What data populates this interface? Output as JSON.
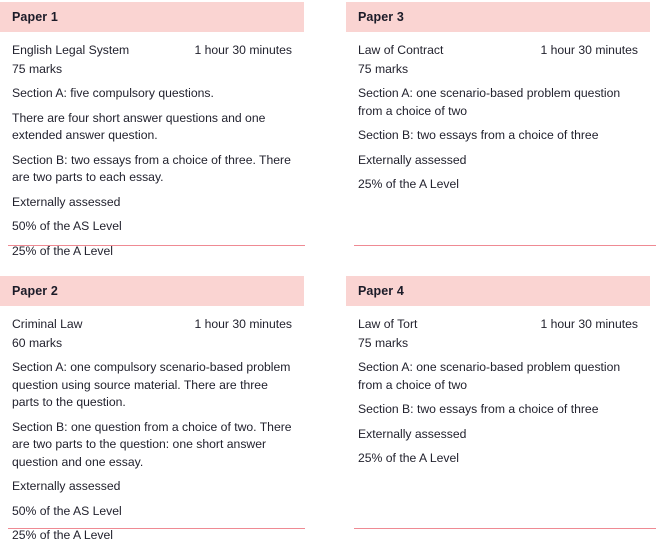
{
  "theme": {
    "header_background": "#fad4d2",
    "rule_color": "#ef8a93",
    "text_color": "#22222e",
    "page_background": "#ffffff"
  },
  "papers": [
    {
      "header": "Paper 1",
      "subject": "English Legal System",
      "duration": "1 hour 30 minutes",
      "marks": "75 marks",
      "paragraphs": [
        "Section A: five compulsory questions.",
        "There are four short answer questions and one extended answer question.",
        "Section B: two essays from a choice of three. There are two parts to each essay.",
        "Externally assessed",
        "50% of the AS Level",
        "25% of the A Level"
      ]
    },
    {
      "header": "Paper 3",
      "subject": "Law of Contract",
      "duration": "1 hour 30 minutes",
      "marks": "75 marks",
      "paragraphs": [
        "Section A: one scenario-based problem question from a choice of two",
        "Section B: two essays from a choice of three",
        "Externally assessed",
        "25% of the A Level"
      ]
    },
    {
      "header": "Paper 2",
      "subject": "Criminal Law",
      "duration": "1 hour 30 minutes",
      "marks": "60 marks",
      "paragraphs": [
        "Section A: one compulsory scenario-based problem question using source material. There are three parts to the question.",
        "Section B: one question from a choice of two. There are two parts to the question: one short answer question and one essay.",
        "Externally assessed",
        "50% of the AS Level",
        "25% of the A Level"
      ]
    },
    {
      "header": "Paper 4",
      "subject": "Law of Tort",
      "duration": "1 hour 30 minutes",
      "marks": "75 marks",
      "paragraphs": [
        "Section A: one scenario-based problem question from a choice of two",
        "Section B: two essays from a choice of three",
        "Externally assessed",
        "25% of the A Level"
      ]
    }
  ]
}
